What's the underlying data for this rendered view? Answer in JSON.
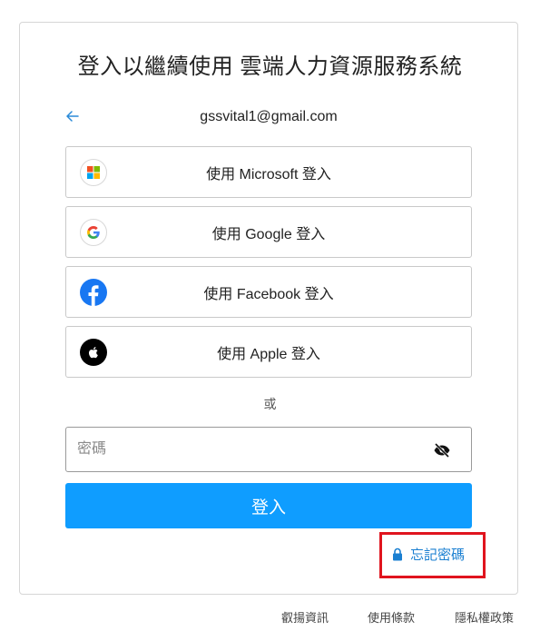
{
  "title": "登入以繼續使用 雲端人力資源服務系統",
  "account": {
    "email": "gssvital1@gmail.com"
  },
  "sso": {
    "microsoft": "使用 Microsoft 登入",
    "google": "使用 Google 登入",
    "facebook": "使用 Facebook 登入",
    "apple": "使用 Apple 登入"
  },
  "divider_text": "或",
  "password": {
    "placeholder": "密碼",
    "value": ""
  },
  "login_button": "登入",
  "forgot_password": "忘記密碼",
  "footer": {
    "cookie": "叡揚資訊",
    "terms": "使用條款",
    "privacy": "隱私權政策"
  },
  "colors": {
    "primary": "#0f9dff",
    "link": "#1a7fd1",
    "highlight": "#e0141e"
  }
}
